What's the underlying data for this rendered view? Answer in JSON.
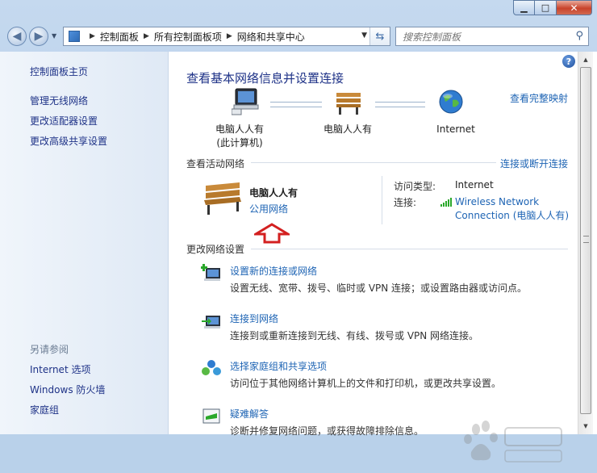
{
  "window": {
    "min_icon": "minimize-icon",
    "max_icon": "maximize-icon",
    "close_icon": "close-icon"
  },
  "address": {
    "crumbs": [
      "控制面板",
      "所有控制面板项",
      "网络和共享中心"
    ],
    "search_placeholder": "搜索控制面板"
  },
  "left": {
    "top_links": [
      "控制面板主页",
      "管理无线网络",
      "更改适配器设置",
      "更改高级共享设置"
    ],
    "see_also": "另请参阅",
    "bottom_links": [
      "Internet 选项",
      "Windows 防火墙",
      "家庭组"
    ]
  },
  "main": {
    "title": "查看基本网络信息并设置连接",
    "full_map": "查看完整映射",
    "map": {
      "node1_line1": "电脑人人有",
      "node1_line2": "(此计算机)",
      "node2": "电脑人人有",
      "node3": "Internet"
    },
    "active_head": "查看活动网络",
    "connect_link": "连接或断开连接",
    "network_name": "电脑人人有",
    "network_type": "公用网络",
    "access_type_label": "访问类型:",
    "access_type_value": "Internet",
    "connection_label": "连接:",
    "connection_value_1": "Wireless Network",
    "connection_value_2": "Connection (电脑人人有)",
    "change_head": "更改网络设置",
    "tasks": [
      {
        "link": "设置新的连接或网络",
        "desc": "设置无线、宽带、拨号、临时或 VPN 连接；或设置路由器或访问点。"
      },
      {
        "link": "连接到网络",
        "desc": "连接到或重新连接到无线、有线、拨号或 VPN 网络连接。"
      },
      {
        "link": "选择家庭组和共享选项",
        "desc": "访问位于其他网络计算机上的文件和打印机，或更改共享设置。"
      },
      {
        "link": "疑难解答",
        "desc": "诊断并修复网络问题，或获得故障排除信息。"
      }
    ]
  },
  "colors": {
    "link": "#1e64b4",
    "title": "#1e3287",
    "arrow": "#d32020"
  }
}
